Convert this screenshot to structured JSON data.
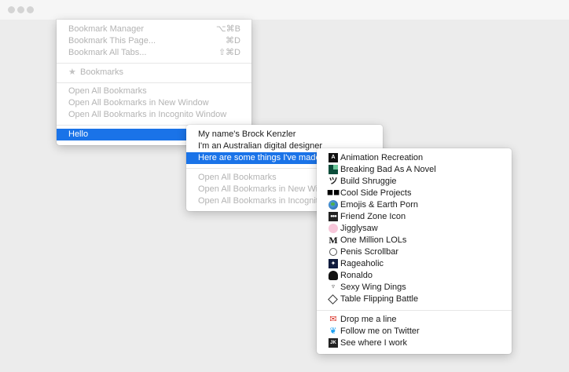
{
  "menu1": {
    "items": [
      {
        "label": "Bookmark Manager",
        "shortcut": "⌥⌘B"
      },
      {
        "label": "Bookmark This Page...",
        "shortcut": "⌘D"
      },
      {
        "label": "Bookmark All Tabs...",
        "shortcut": "⇧⌘D"
      }
    ],
    "bookmarks_label": "Bookmarks",
    "open_items": [
      "Open All Bookmarks",
      "Open All Bookmarks in New Window",
      "Open All Bookmarks in Incognito Window"
    ],
    "hello_label": "Hello"
  },
  "menu2": {
    "items": [
      "My name's Brock Kenzler",
      "I'm an Australian digital designer",
      "Here are some things I've made"
    ],
    "open_items": [
      "Open All Bookmarks",
      "Open All Bookmarks in New Window",
      "Open All Bookmarks in Incognito Window"
    ]
  },
  "menu3": {
    "projects": [
      {
        "label": "Animation Recreation",
        "icon": "animation-recreation-icon"
      },
      {
        "label": "Breaking Bad As A Novel",
        "icon": "breaking-bad-icon"
      },
      {
        "label": "Build Shruggie",
        "icon": "shruggie-icon"
      },
      {
        "label": "Cool Side Projects",
        "icon": "sunglasses-icon"
      },
      {
        "label": "Emojis & Earth Porn",
        "icon": "earth-icon"
      },
      {
        "label": "Friend Zone Icon",
        "icon": "friend-zone-icon"
      },
      {
        "label": "Jigglysaw",
        "icon": "jigglypuff-icon"
      },
      {
        "label": "One Million LOLs",
        "icon": "m-letter-icon"
      },
      {
        "label": "Penis Scrollbar",
        "icon": "scrollbar-icon"
      },
      {
        "label": "Rageaholic",
        "icon": "rage-icon"
      },
      {
        "label": "Ronaldo",
        "icon": "ronaldo-icon"
      },
      {
        "label": "Sexy Wing Dings",
        "icon": "wing-icon"
      },
      {
        "label": "Table Flipping Battle",
        "icon": "table-flip-icon"
      }
    ],
    "contact": [
      {
        "label": "Drop me a line",
        "icon": "gmail-icon"
      },
      {
        "label": "Follow me on Twitter",
        "icon": "twitter-icon"
      },
      {
        "label": "See where I work",
        "icon": "workplace-icon"
      }
    ]
  },
  "colors": {
    "selection": "#1a73e8",
    "disabled_text": "#b3b3b3",
    "background": "#ececec"
  }
}
